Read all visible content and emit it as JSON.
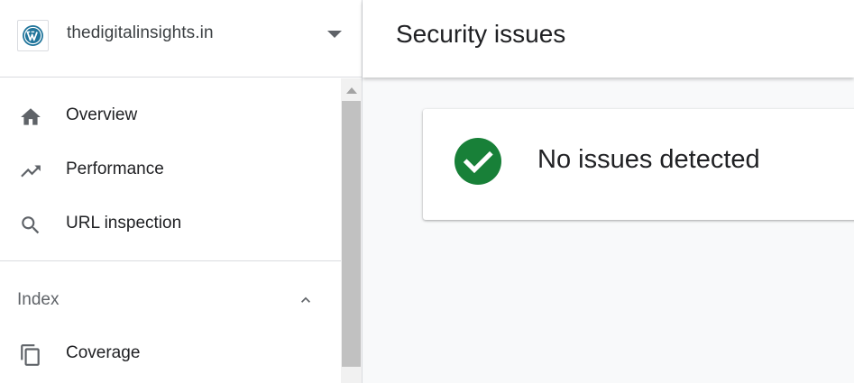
{
  "property": {
    "name": "thedigitalinsights.in",
    "logo_icon": "wordpress-icon"
  },
  "nav": {
    "items": [
      {
        "label": "Overview",
        "icon": "home-icon"
      },
      {
        "label": "Performance",
        "icon": "trending-up-icon"
      },
      {
        "label": "URL inspection",
        "icon": "search-icon"
      }
    ],
    "sections": [
      {
        "label": "Index",
        "expanded": true,
        "items": [
          {
            "label": "Coverage",
            "icon": "copy-pages-icon"
          }
        ]
      }
    ]
  },
  "header": {
    "title": "Security issues"
  },
  "status": {
    "message": "No issues detected",
    "icon": "check-circle-icon",
    "color": "#188038"
  },
  "colors": {
    "icon_grey": "#5f6368",
    "text_dark": "#202124",
    "divider": "#dadce0"
  }
}
